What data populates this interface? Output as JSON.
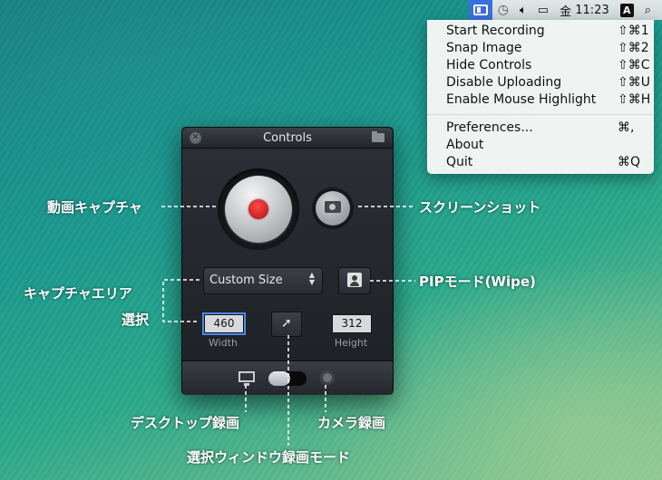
{
  "menubar": {
    "clock": "11:23",
    "day": "金",
    "input_source": "A"
  },
  "menu": {
    "items": [
      {
        "label": "Start Recording",
        "shortcut": "⇧⌘1"
      },
      {
        "label": "Snap Image",
        "shortcut": "⇧⌘2"
      },
      {
        "label": "Hide Controls",
        "shortcut": "⇧⌘C"
      },
      {
        "label": "Disable Uploading",
        "shortcut": "⇧⌘U"
      },
      {
        "label": "Enable Mouse Highlight",
        "shortcut": "⇧⌘H"
      },
      {
        "label": "Preferences...",
        "shortcut": "⌘,"
      },
      {
        "label": "About",
        "shortcut": ""
      },
      {
        "label": "Quit",
        "shortcut": "⌘Q"
      }
    ]
  },
  "panel": {
    "title": "Controls",
    "size_select": "Custom Size",
    "width_value": "460",
    "height_value": "312",
    "width_label": "Width",
    "height_label": "Height"
  },
  "annotations": {
    "video_capture": "動画キャプチャ",
    "screenshot": "スクリーンショット",
    "capture_area_1": "キャプチャエリア",
    "capture_area_2": "選択",
    "pip_mode": "PIPモード(Wipe)",
    "desktop_record": "デスクトップ録画",
    "camera_record": "カメラ録画",
    "window_record": "選択ウィンドウ録画モード"
  }
}
